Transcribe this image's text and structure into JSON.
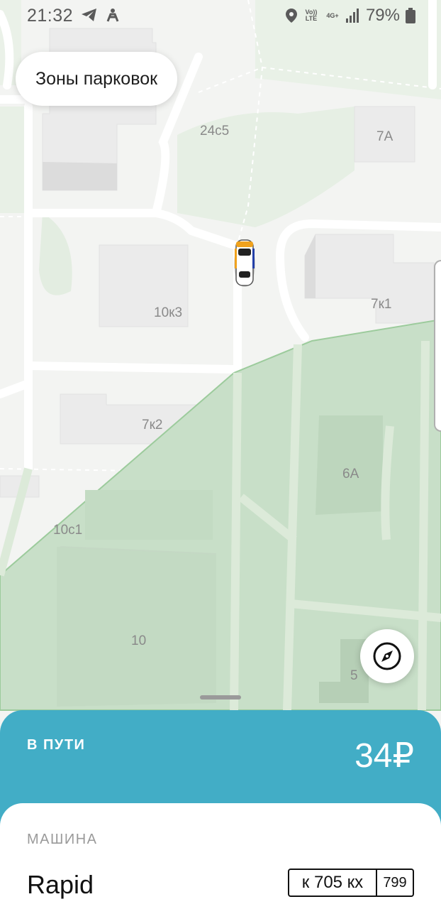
{
  "status_bar": {
    "time": "21:32",
    "battery": "79%",
    "volte": "Vo)) LTE",
    "network": "4G+",
    "icons": [
      "telegram-icon",
      "mobile-accessibility-icon",
      "location-icon",
      "signal-icon",
      "battery-icon"
    ]
  },
  "map": {
    "zones_button": "Зоны парковок",
    "labels": {
      "b24c5": "24с5",
      "b7a": "7А",
      "b10k3": "10к3",
      "b7k1": "7к1",
      "b7k2": "7к2",
      "b6a": "6А",
      "b10c1": "10с1",
      "b10": "10",
      "b5": "5"
    },
    "zone_color": "#c8dfc8",
    "car_icon": "car-marker-icon",
    "compass_icon": "compass-icon"
  },
  "trip": {
    "status": "В ПУТИ",
    "price": "34₽",
    "accent": "#42adc6"
  },
  "car": {
    "section_title": "МАШИНА",
    "model": "Rapid",
    "plate_number": "к 705 кх",
    "plate_region": "799"
  }
}
